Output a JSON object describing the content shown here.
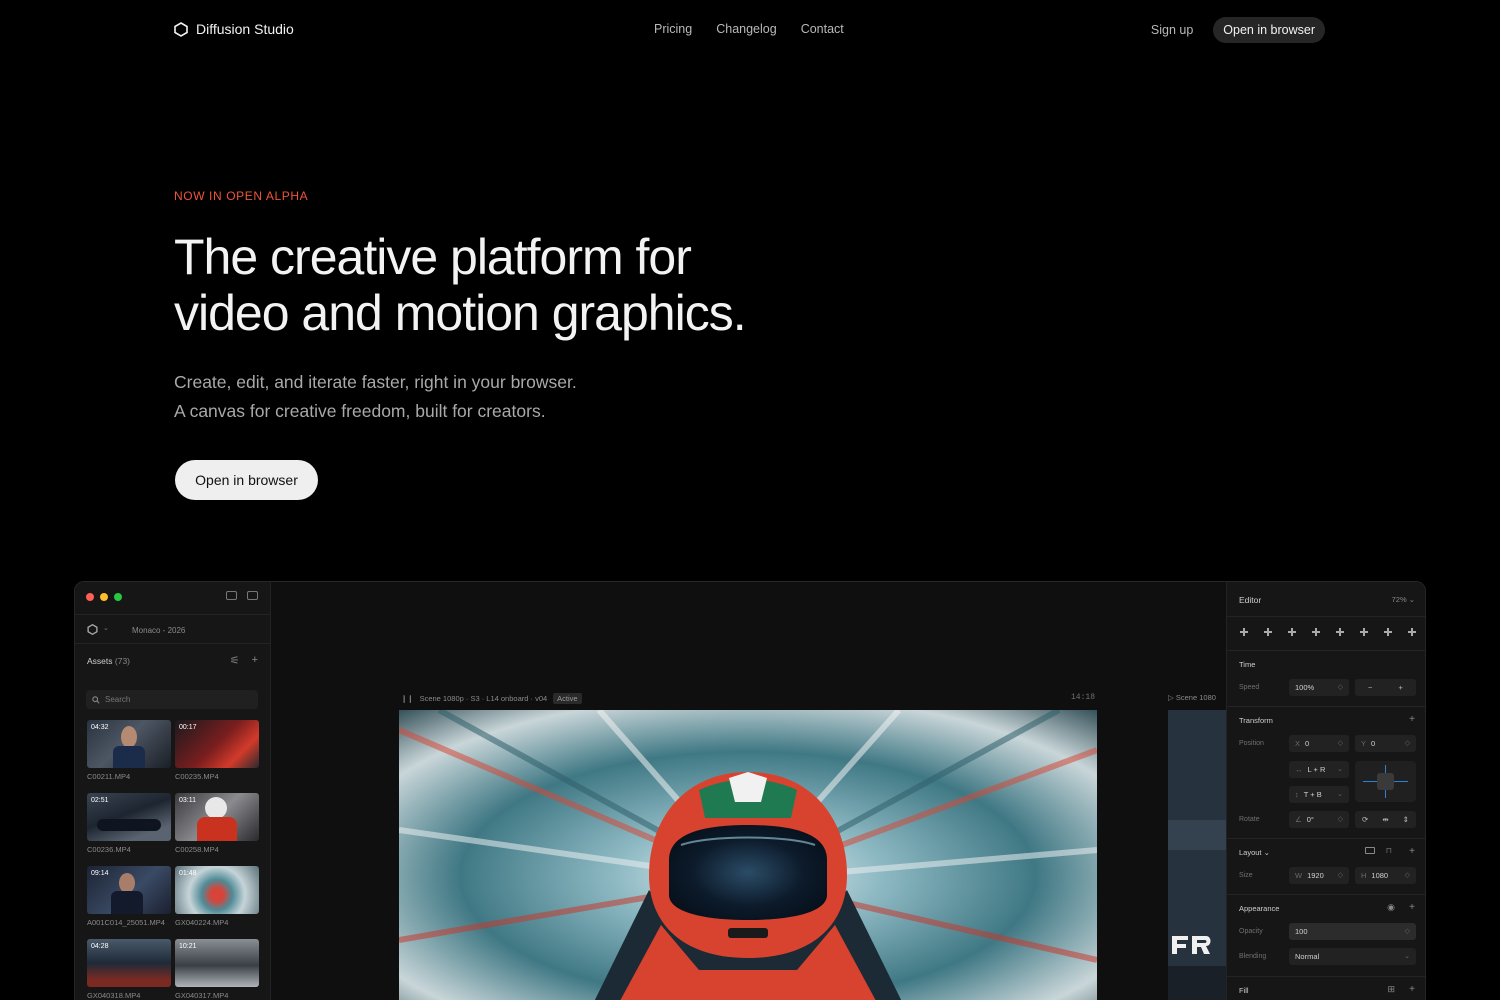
{
  "nav": {
    "brand": "Diffusion Studio",
    "links": [
      "Pricing",
      "Changelog",
      "Contact"
    ],
    "signup": "Sign up",
    "cta": "Open in browser"
  },
  "hero": {
    "badge": "NOW IN OPEN ALPHA",
    "headline_1": "The creative platform for",
    "headline_2": "video and motion graphics.",
    "sub_1": "Create, edit, and iterate faster, right in your browser.",
    "sub_2": "A canvas for creative freedom, built for creators.",
    "cta": "Open in browser"
  },
  "app": {
    "project": "Monaco - 2026",
    "assets_label": "Assets",
    "assets_count": "(73)",
    "search_placeholder": "Search",
    "assets": [
      {
        "duration": "04:32",
        "name": "C00211.MP4"
      },
      {
        "duration": "00:17",
        "name": "C00235.MP4"
      },
      {
        "duration": "02:51",
        "name": "C00236.MP4"
      },
      {
        "duration": "03:11",
        "name": "C00258.MP4"
      },
      {
        "duration": "09:14",
        "name": "A001C014_25051.MP4"
      },
      {
        "duration": "01:48",
        "name": "GX040224.MP4"
      },
      {
        "duration": "04:28",
        "name": "GX040318.MP4"
      },
      {
        "duration": "10:21",
        "name": "GX040317.MP4"
      }
    ],
    "scene_label": "Scene 1080p · S3 · L14 onboard · v04",
    "scene_status": "Active",
    "timecode": "14:18",
    "scene2_label": "Scene 1080",
    "inspector": {
      "title": "Editor",
      "zoom": "72%",
      "time_section": "Time",
      "speed_label": "Speed",
      "speed_value": "100%",
      "transform_section": "Transform",
      "position_label": "Position",
      "pos_x_key": "X",
      "pos_x": "0",
      "pos_y_key": "Y",
      "pos_y": "0",
      "constraint_h": "L + R",
      "constraint_v": "T + B",
      "rotate_label": "Rotate",
      "rotate_value": "0°",
      "layout_section": "Layout",
      "size_label": "Size",
      "width_key": "W",
      "width": "1920",
      "height_key": "H",
      "height": "1080",
      "appearance_section": "Appearance",
      "opacity_label": "Opacity",
      "opacity_value": "100",
      "blending_label": "Blending",
      "blending_value": "Normal",
      "fill_section": "Fill"
    }
  },
  "colors": {
    "background": "#000000",
    "accent": "#f0533a",
    "cta_light": "#efefef",
    "panel": "#161616",
    "selection_blue": "#2f7fd6"
  }
}
